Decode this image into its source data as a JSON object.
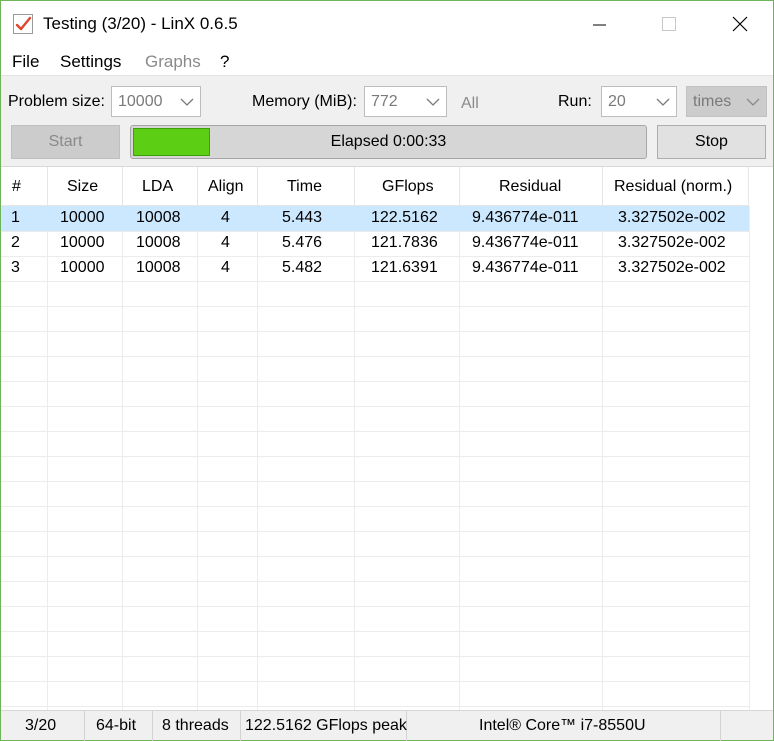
{
  "window": {
    "title": "Testing (3/20) - LinX 0.6.5",
    "icon": "checkmark-app-icon"
  },
  "menu": {
    "file": "File",
    "settings": "Settings",
    "graphs": "Graphs",
    "help": "?"
  },
  "toolbar": {
    "problem_size_label": "Problem size:",
    "problem_size_value": "10000",
    "memory_label": "Memory (MiB):",
    "memory_value": "772",
    "all_label": "All",
    "run_label": "Run:",
    "run_value": "20",
    "times_value": "times",
    "start_label": "Start",
    "stop_label": "Stop",
    "elapsed_text": "Elapsed 0:00:33",
    "progress_fraction": 0.15,
    "progress_color": "#5ccf14"
  },
  "table": {
    "columns": [
      "#",
      "Size",
      "LDA",
      "Align",
      "Time",
      "GFlops",
      "Residual",
      "Residual (norm.)"
    ],
    "rows": [
      [
        "1",
        "10000",
        "10008",
        "4",
        "5.443",
        "122.5162",
        "9.436774e-011",
        "3.327502e-002"
      ],
      [
        "2",
        "10000",
        "10008",
        "4",
        "5.476",
        "121.7836",
        "9.436774e-011",
        "3.327502e-002"
      ],
      [
        "3",
        "10000",
        "10008",
        "4",
        "5.482",
        "121.6391",
        "9.436774e-011",
        "3.327502e-002"
      ]
    ],
    "selected_color": "#cce8ff"
  },
  "status": {
    "progress": "3/20",
    "bits": "64-bit",
    "threads": "8 threads",
    "peak": "122.5162 GFlops peak",
    "cpu": "Intel® Core™ i7-8550U"
  }
}
